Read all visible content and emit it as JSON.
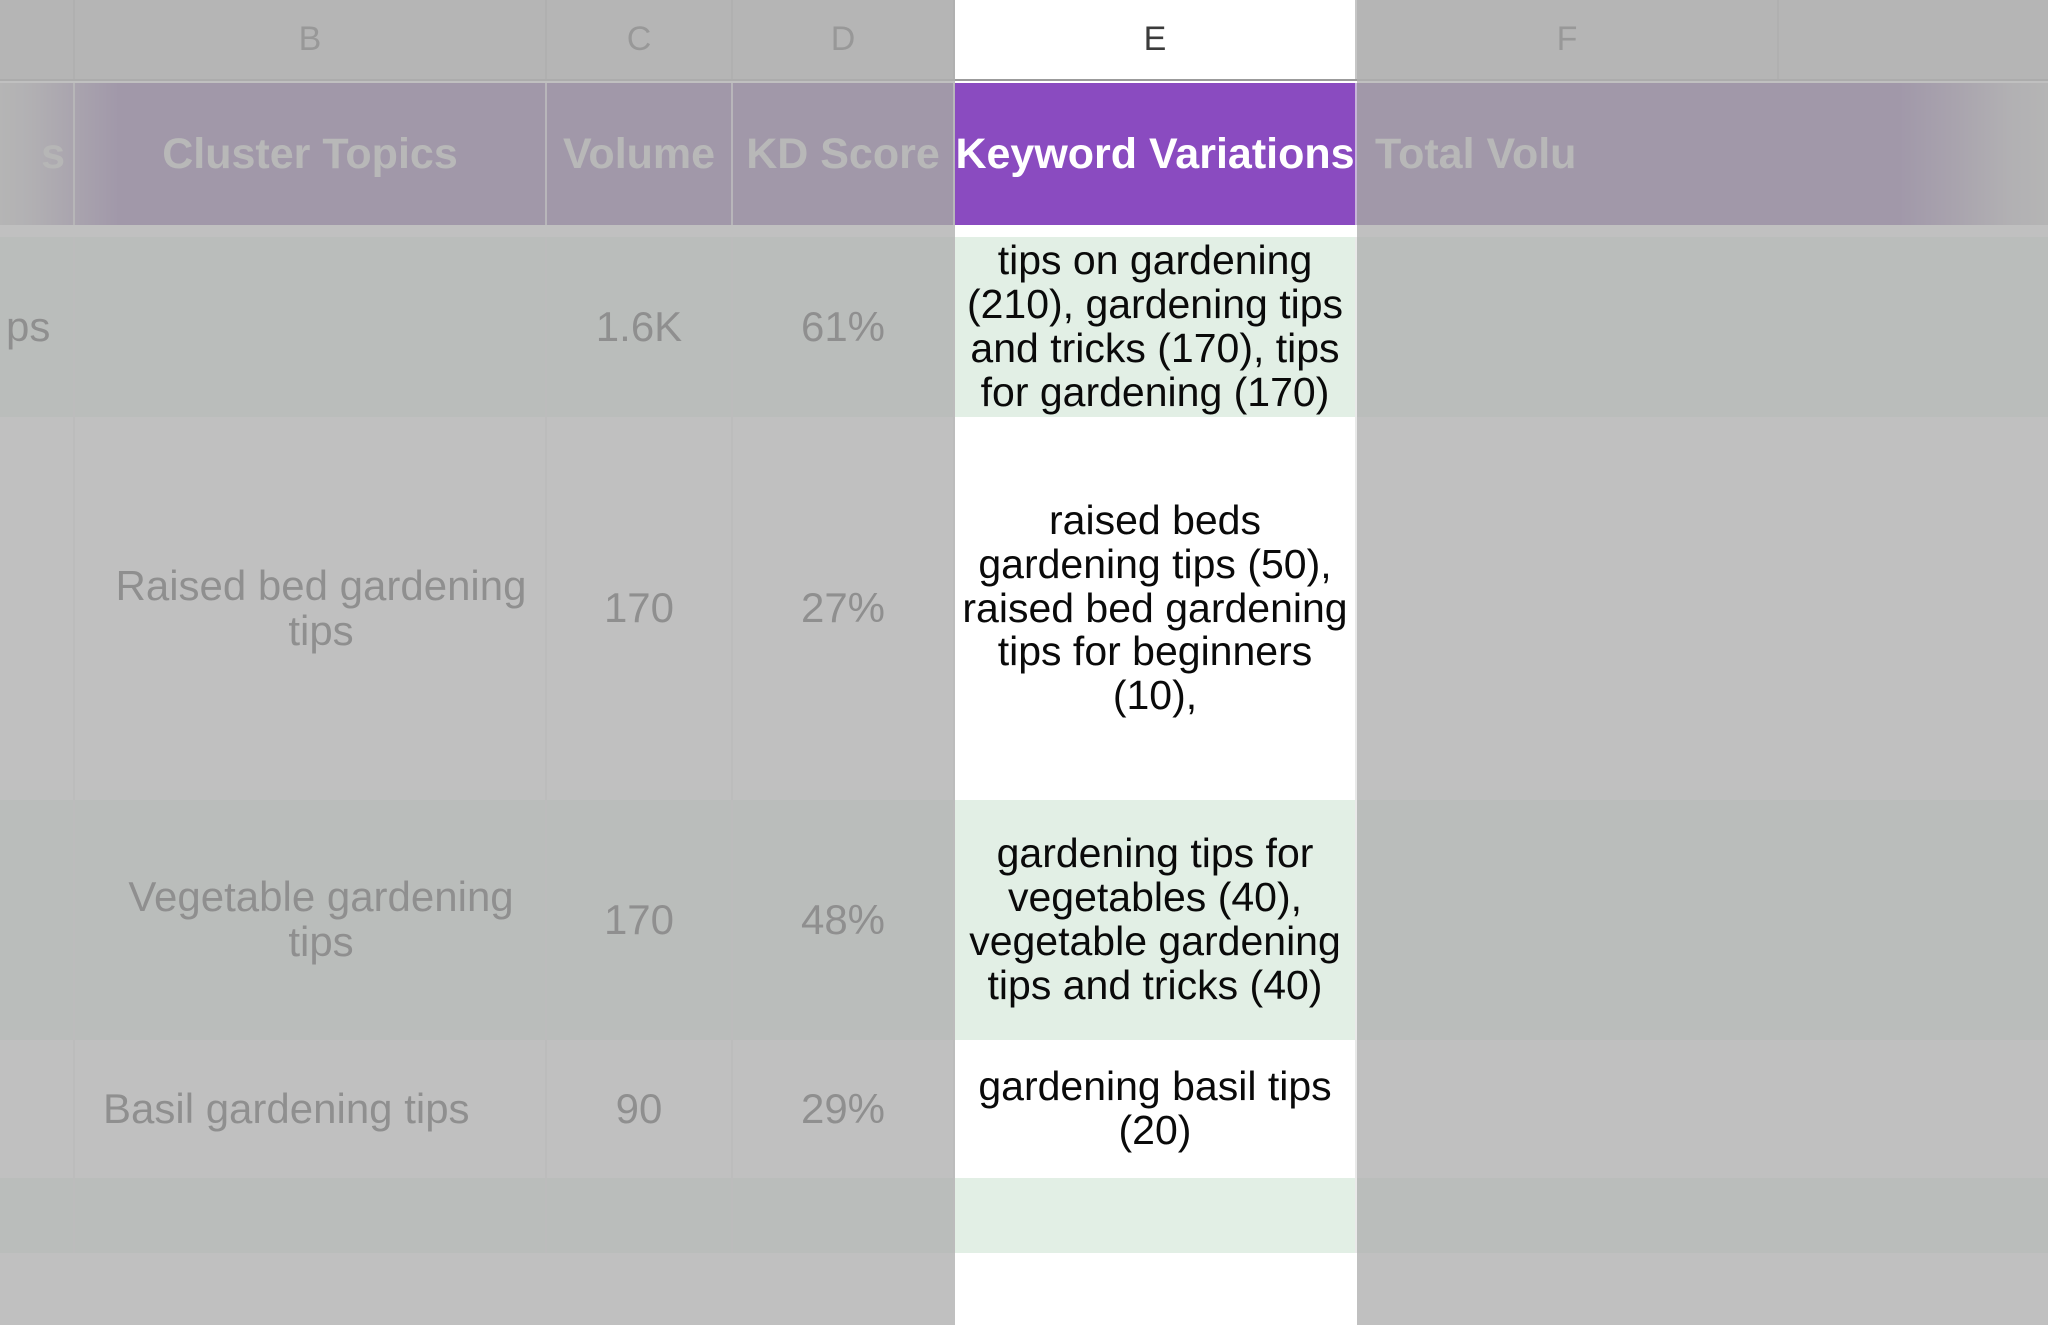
{
  "app": {
    "type": "spreadsheet",
    "highlighted_column": "E"
  },
  "colors": {
    "header_purple": "#663a8e",
    "header_purple_highlight": "#8a4bc0",
    "row_mint": "#e2efe5",
    "row_white": "#ffffff",
    "column_strip_gray": "#c6c6c6",
    "veil_gray": "#b0b0b0"
  },
  "column_letters": [
    {
      "id": "A",
      "label": ""
    },
    {
      "id": "B",
      "label": "B"
    },
    {
      "id": "C",
      "label": "C"
    },
    {
      "id": "D",
      "label": "D"
    },
    {
      "id": "E",
      "label": "E"
    },
    {
      "id": "F",
      "label": "F"
    }
  ],
  "table": {
    "headers": [
      {
        "col": "A",
        "label": "s"
      },
      {
        "col": "B",
        "label": "Cluster Topics"
      },
      {
        "col": "C",
        "label": "Volume"
      },
      {
        "col": "D",
        "label": "KD Score"
      },
      {
        "col": "E",
        "label": "Keyword Variations"
      },
      {
        "col": "F",
        "label": "Total Volu"
      }
    ],
    "rows": [
      {
        "a": "ps",
        "topic": "",
        "volume": "1.6K",
        "kd": "61%",
        "variations": "tips on gardening (210), gardening tips and tricks (170), tips for gardening (170)",
        "total_volume": ""
      },
      {
        "a": "",
        "topic": "Raised bed gardening tips",
        "volume": "170",
        "kd": "27%",
        "variations": "raised beds gardening tips (50), raised bed gardening tips for beginners (10),",
        "total_volume": ""
      },
      {
        "a": "",
        "topic": "Vegetable gardening tips",
        "volume": "170",
        "kd": "48%",
        "variations": "gardening tips for vegetables (40), vegetable gardening tips and tricks (40)",
        "total_volume": ""
      },
      {
        "a": "",
        "topic": "Basil gardening tips",
        "volume": "90",
        "kd": "29%",
        "variations": "gardening basil tips (20)",
        "total_volume": ""
      },
      {
        "a": "",
        "topic": "",
        "volume": "",
        "kd": "",
        "variations": "",
        "total_volume": ""
      }
    ]
  }
}
